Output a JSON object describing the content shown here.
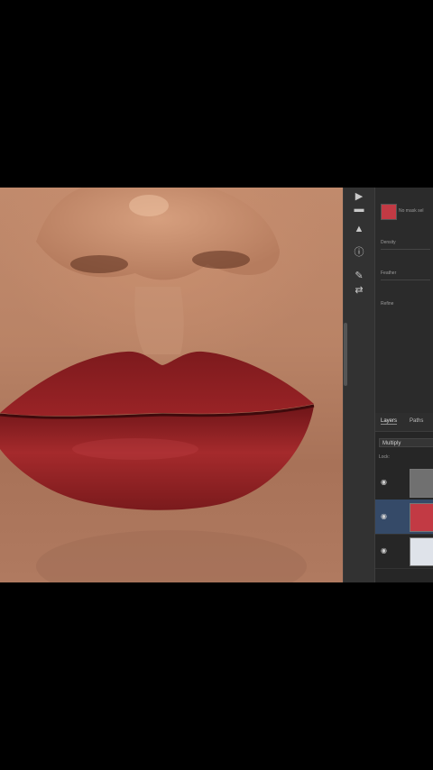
{
  "props": {
    "swatch_color": "#c23a44",
    "swatch_label": "No mask sel",
    "field1": "Density",
    "field2": "Feather",
    "field3": "Refine"
  },
  "layers_panel": {
    "tabs": [
      "Layers",
      "Paths"
    ],
    "blend_mode": "Multiply",
    "lock_label": "Lock:"
  },
  "colors": {
    "lip": "#8e1f22",
    "skin": "#b98366",
    "panel": "#2a2a2a"
  }
}
